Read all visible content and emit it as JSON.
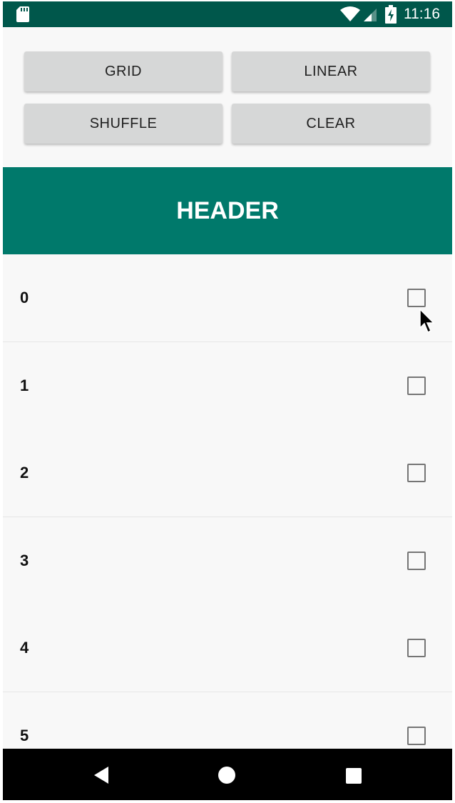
{
  "status_bar": {
    "time": "11:16",
    "icons": [
      "sd-card-icon",
      "wifi-icon",
      "signal-icon",
      "battery-charging-icon"
    ],
    "background": "#00574b"
  },
  "buttons": {
    "grid": "GRID",
    "linear": "LINEAR",
    "shuffle": "SHUFFLE",
    "clear": "CLEAR"
  },
  "header": {
    "title": "HEADER",
    "background": "#00796b"
  },
  "list": {
    "items": [
      {
        "label": "0",
        "checked": false
      },
      {
        "label": "1",
        "checked": false
      },
      {
        "label": "2",
        "checked": false
      },
      {
        "label": "3",
        "checked": false
      },
      {
        "label": "4",
        "checked": false
      },
      {
        "label": "5",
        "checked": false
      }
    ]
  },
  "nav_bar": {
    "icons": [
      "back-icon",
      "home-icon",
      "recents-icon"
    ]
  }
}
